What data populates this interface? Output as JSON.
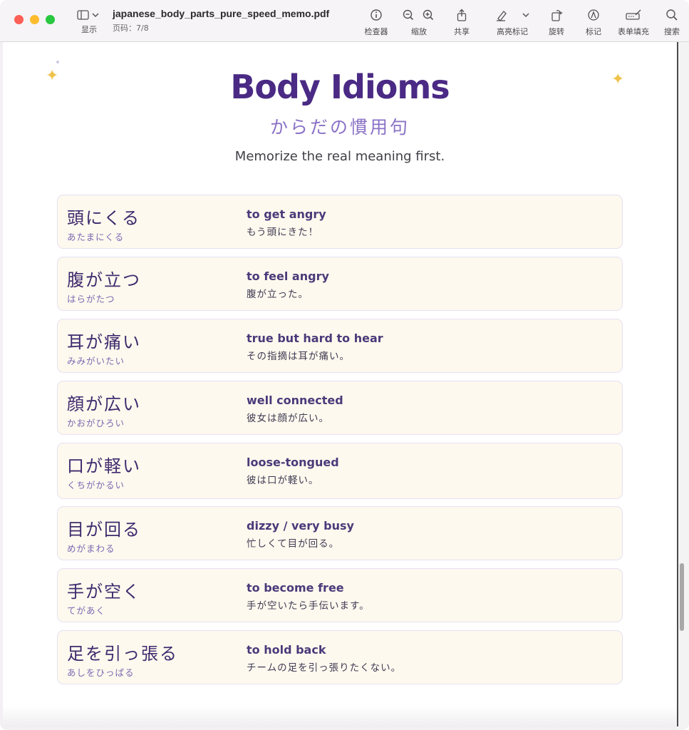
{
  "window": {
    "title": "japanese_body_parts_pure_speed_memo.pdf",
    "page_indicator": "页码：7/8"
  },
  "toolbar": {
    "display_label": "显示",
    "inspector_label": "检查器",
    "zoom_label": "缩放",
    "share_label": "共享",
    "highlight_label": "高亮标记",
    "rotate_label": "旋转",
    "markup_label": "标记",
    "form_fill_label": "表单填充",
    "search_label": "搜索"
  },
  "document": {
    "title": "Body Idioms",
    "subtitle_jp": "からだの慣用句",
    "tagline": "Memorize the real meaning first."
  },
  "idioms": [
    {
      "idiom": "頭にくる",
      "reading": "あたまにくる",
      "meaning": "to get angry",
      "example": "もう頭にきた！"
    },
    {
      "idiom": "腹が立つ",
      "reading": "はらがたつ",
      "meaning": "to feel angry",
      "example": "腹が立った。"
    },
    {
      "idiom": "耳が痛い",
      "reading": "みみがいたい",
      "meaning": "true but hard to hear",
      "example": "その指摘は耳が痛い。"
    },
    {
      "idiom": "顔が広い",
      "reading": "かおがひろい",
      "meaning": "well connected",
      "example": "彼女は顔が広い。"
    },
    {
      "idiom": "口が軽い",
      "reading": "くちがかるい",
      "meaning": "loose-tongued",
      "example": "彼は口が軽い。"
    },
    {
      "idiom": "目が回る",
      "reading": "めがまわる",
      "meaning": "dizzy / very busy",
      "example": "忙しくて目が回る。"
    },
    {
      "idiom": "手が空く",
      "reading": "てがあく",
      "meaning": "to become free",
      "example": "手が空いたら手伝います。"
    },
    {
      "idiom": "足を引っ張る",
      "reading": "あしをひっぱる",
      "meaning": "to hold back",
      "example": "チームの足を引っ張りたくない。"
    }
  ],
  "colors": {
    "title": "#4a2a84",
    "accent": "#8a72c6",
    "card_bg": "#fef9ee",
    "sparkle": "#f0c24b"
  }
}
